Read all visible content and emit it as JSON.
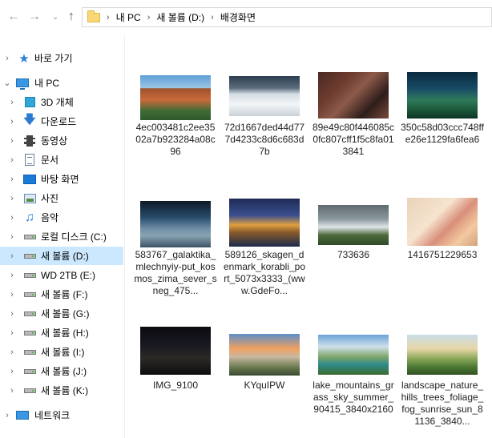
{
  "address": {
    "crumbs": [
      "내 PC",
      "새 볼륨 (D:)",
      "배경화면"
    ]
  },
  "nav": {
    "items": [
      {
        "label": "바로 가기",
        "icon": "star-icon"
      },
      {
        "label": "내 PC",
        "icon": "computer-icon"
      },
      {
        "label": "3D 개체",
        "icon": "3d-objects-icon"
      },
      {
        "label": "다운로드",
        "icon": "download-icon"
      },
      {
        "label": "동영상",
        "icon": "video-icon"
      },
      {
        "label": "문서",
        "icon": "document-icon"
      },
      {
        "label": "바탕 화면",
        "icon": "desktop-icon"
      },
      {
        "label": "사진",
        "icon": "pictures-icon"
      },
      {
        "label": "음악",
        "icon": "music-icon"
      },
      {
        "label": "로컬 디스크 (C:)",
        "icon": "drive-icon"
      },
      {
        "label": "새 볼륨 (D:)",
        "icon": "drive-icon"
      },
      {
        "label": "WD 2TB (E:)",
        "icon": "drive-icon"
      },
      {
        "label": "새 볼륨 (F:)",
        "icon": "drive-icon"
      },
      {
        "label": "새 볼륨 (G:)",
        "icon": "drive-icon"
      },
      {
        "label": "새 볼륨 (H:)",
        "icon": "drive-icon"
      },
      {
        "label": "새 볼륨 (I:)",
        "icon": "drive-icon"
      },
      {
        "label": "새 볼륨 (J:)",
        "icon": "drive-icon"
      },
      {
        "label": "새 볼륨 (K:)",
        "icon": "drive-icon"
      },
      {
        "label": "네트워크",
        "icon": "network-icon"
      }
    ]
  },
  "files": [
    {
      "name": "4ec003481c2ee3502a7b923284a08c96"
    },
    {
      "name": "72d1667ded44d777d4233c8d6c683d7b"
    },
    {
      "name": "89e49c80f446085c0fc807cff1f5c8fa013841"
    },
    {
      "name": "350c58d03ccc748ffe26e1129fa6fea6"
    },
    {
      "name": "583767_galaktika_mlechnyiy-put_kosmos_zima_sever_sneg_475..."
    },
    {
      "name": "589126_skagen_denmark_korabli_port_5073x3333_(www.GdeFo..."
    },
    {
      "name": "733636"
    },
    {
      "name": "1416751229653"
    },
    {
      "name": "IMG_9100"
    },
    {
      "name": "KYquIPW"
    },
    {
      "name": "lake_mountains_grass_sky_summer_90415_3840x2160"
    },
    {
      "name": "landscape_nature_hills_trees_foliage_fog_sunrise_sun_81136_3840..."
    }
  ]
}
